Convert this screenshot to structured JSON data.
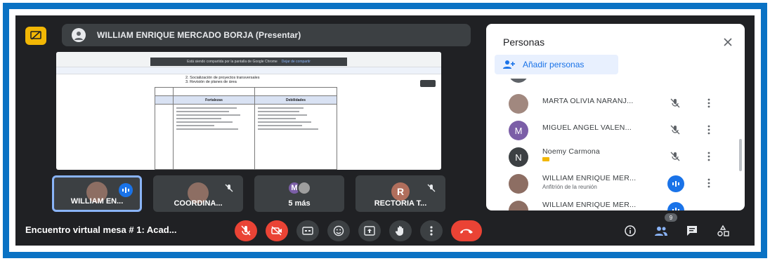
{
  "presenter": {
    "name": "WILLIAM ENRIQUE MERCADO BORJA (Presentar)"
  },
  "screen_share": {
    "banner_text": "Está siendo compartida por la pantalla de Google Chrome",
    "banner_button": "Dejar de compartir",
    "doc_headings": [
      "2. Socialización de proyectos transversales",
      "3. Revisión de planes de área"
    ],
    "table_headers": [
      "Fortalezas",
      "Debilidades"
    ]
  },
  "tiles": [
    {
      "label": "WILLIAM EN...",
      "type": "avatar",
      "speaking": true
    },
    {
      "label": "COORDINA...",
      "type": "avatar",
      "muted": true
    },
    {
      "label": "5 más",
      "type": "multi",
      "letter": "M"
    },
    {
      "label": "RECTORIA T...",
      "type": "letter",
      "letter": "R",
      "muted": true
    }
  ],
  "meeting": {
    "title": "Encuentro virtual mesa # 1: Acad..."
  },
  "controls": [
    {
      "name": "mic-off-button",
      "style": "red"
    },
    {
      "name": "camera-off-button",
      "style": "red"
    },
    {
      "name": "captions-button",
      "style": "grey"
    },
    {
      "name": "emoji-button",
      "style": "grey"
    },
    {
      "name": "present-button",
      "style": "grey"
    },
    {
      "name": "raise-hand-button",
      "style": "grey"
    },
    {
      "name": "more-options-button",
      "style": "grey"
    },
    {
      "name": "leave-call-button",
      "style": "end"
    }
  ],
  "participant_count": "9",
  "panel": {
    "title": "Personas",
    "add_people": "Añadir personas",
    "people": [
      {
        "name": "MARTA OLIVIA NARANJ...",
        "subtitle": "",
        "avatar": "photo",
        "state": "muted"
      },
      {
        "name": "MIGUEL ANGEL VALEN...",
        "subtitle": "",
        "avatar": "M",
        "avatar_color": "#7b5ea7",
        "state": "muted"
      },
      {
        "name": "Noemy Carmona",
        "subtitle": "",
        "avatar": "N",
        "avatar_color": "#3c4043",
        "state": "muted",
        "hand": true
      },
      {
        "name": "WILLIAM ENRIQUE MER...",
        "subtitle": "Anfitrión de la reunión",
        "avatar": "photo",
        "state": "speaking"
      },
      {
        "name": "WILLIAM ENRIQUE MER...",
        "subtitle": "",
        "avatar": "photo",
        "state": "speaking"
      }
    ]
  },
  "colors": {
    "frame": "#0a72c4",
    "meet_bg": "#202124",
    "red": "#ea4335",
    "blue": "#1a73e8",
    "present_badge": "#f2b705"
  }
}
